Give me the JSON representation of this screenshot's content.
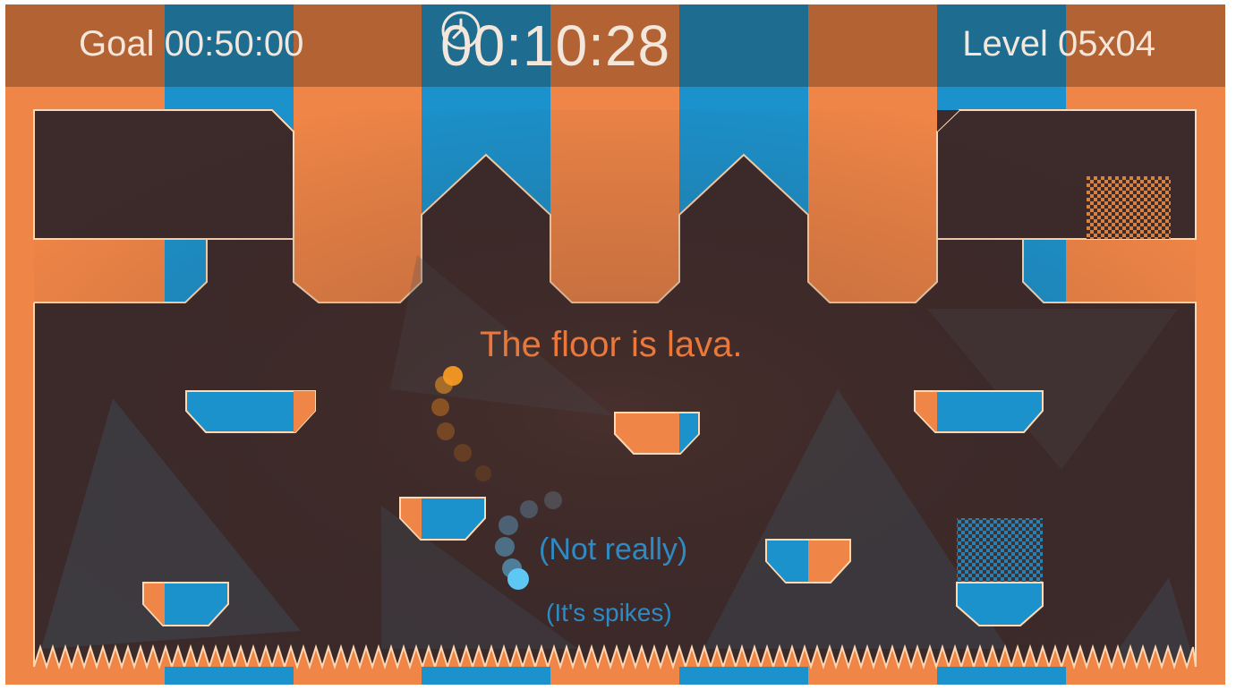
{
  "hud": {
    "goal": "Goal 00:50:00",
    "timer": "00:10:28",
    "level": "Level 05x04",
    "timer_icon": "clock-icon"
  },
  "messages": {
    "hint_main": "The floor is lava.",
    "hint_not_really": "(Not really)",
    "hint_spikes": "(It's spikes)"
  },
  "colors": {
    "orange": "#ef8547",
    "blue": "#1c92cc",
    "dark_interior": "#3d2a2a",
    "outline": "#ffd9b3",
    "text_orange": "#e9783a",
    "text_blue": "#2f8ac4",
    "player": "#5ec8f5",
    "trail": "#f59a23"
  }
}
